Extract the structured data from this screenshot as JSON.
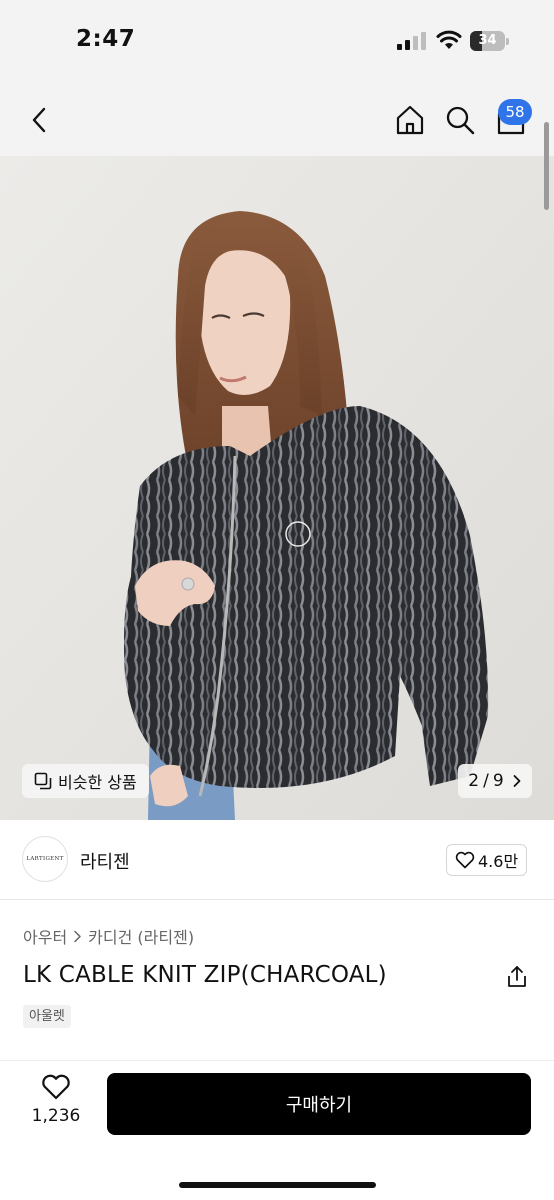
{
  "status_bar": {
    "time": "2:47",
    "battery": "34",
    "battery_level": 0.34
  },
  "nav": {
    "back_icon": "chevron-left-icon",
    "home_icon": "home-icon",
    "search_icon": "search-icon",
    "cart_icon": "cart-icon",
    "cart_count": "58",
    "badge_color": "#2f74e8"
  },
  "gallery": {
    "similar_label": "비슷한 상품",
    "current_page": "2",
    "separator": "/",
    "total_pages": "9"
  },
  "brand": {
    "logo_text": "LARTIGENT",
    "name": "라티젠",
    "likes": "4.6만"
  },
  "product": {
    "breadcrumb": [
      "아우터",
      "카디건 (라티젠)"
    ],
    "title": "LK CABLE KNIT ZIP(CHARCOAL)",
    "tag": "아울렛"
  },
  "bottom_bar": {
    "wish_count": "1,236",
    "buy_label": "구매하기"
  }
}
